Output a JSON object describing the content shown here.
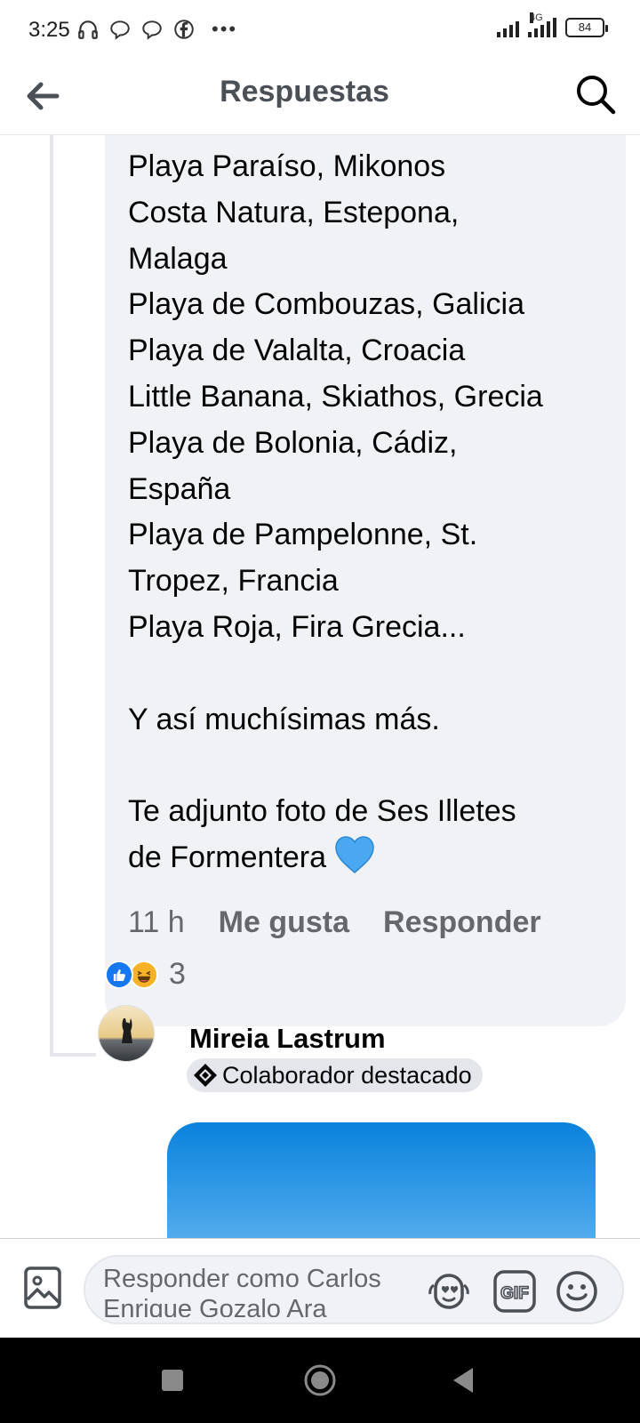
{
  "status_bar": {
    "time": "3:25",
    "network": "4G",
    "battery": "84"
  },
  "header": {
    "title": "Respuestas"
  },
  "comment": {
    "body": "Playa Paraíso, Mikonos\nCosta Natura, Estepona,\nMalaga\nPlaya de Combouzas, Galicia\nPlaya de Valalta, Croacia\nLittle Banana, Skiathos, Grecia\nPlaya de Bolonia, Cádiz,\nEspaña\nPlaya de Pampelonne, St.\nTropez, Francia\nPlaya Roja, Fira Grecia...\n\nY así muchísimas más.\n\nTe adjunto foto de Ses Illetes\nde Formentera ",
    "time": "11 h",
    "like_label": "Me gusta",
    "reply_label": "Responder",
    "reaction_count": "3"
  },
  "reply": {
    "author": "Mireia Lastrum",
    "badge": "Colaborador destacado"
  },
  "composer": {
    "placeholder": "Responder como Carlos Enrique Gozalo Ara"
  },
  "colors": {
    "accent": "#1877f2",
    "bubble": "#f0f2f5",
    "secondary_text": "#65676b",
    "heart": "#4aa8f0"
  },
  "icons": [
    "back-arrow-icon",
    "search-icon",
    "heart-icon",
    "like-reaction-icon",
    "haha-reaction-icon",
    "featured-contributor-icon",
    "photo-icon",
    "sticker-icon",
    "gif-icon",
    "emoji-icon"
  ]
}
